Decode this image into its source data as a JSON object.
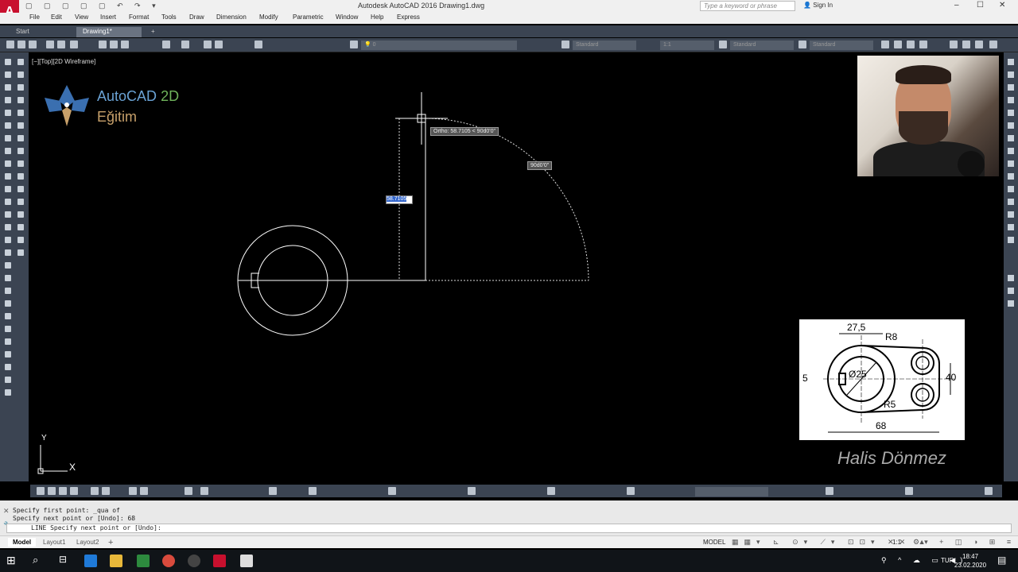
{
  "window": {
    "title": "Autodesk AutoCAD 2016    Drawing1.dwg",
    "app_icon": "A",
    "search_placeholder": "Type a keyword or phrase",
    "signin": "Sign In",
    "minimize": "–",
    "restore": "☐",
    "close": "✕"
  },
  "menu": [
    "File",
    "Edit",
    "View",
    "Insert",
    "Format",
    "Tools",
    "Draw",
    "Dimension",
    "Modify",
    "Parametric",
    "Window",
    "Help",
    "Express"
  ],
  "tabs": [
    {
      "label": "Start",
      "active": false
    },
    {
      "label": "Drawing1*",
      "active": true
    }
  ],
  "tab_add": "+",
  "toolbar": {
    "layer_value": "0",
    "textstyle": "Standard",
    "scale": "1:1",
    "dimstyle": "Standard",
    "tablestyle": "Standard"
  },
  "viewport": {
    "label": "[−][Top][2D Wireframe]"
  },
  "logo": {
    "line1": "AutoCAD",
    "line1b": "2D",
    "line2": "Eğitim"
  },
  "drawing": {
    "ortho_tooltip": "Ortho: 58.7105 < 90d0'0\"",
    "angle_tooltip": "90d0'0\"",
    "dyn_input": "58.7105",
    "ucs_x": "X",
    "ucs_y": "Y"
  },
  "reference": {
    "dim_top": "27,5",
    "dim_r8": "R8",
    "dim_dia": "Ø25",
    "dim_5": "5",
    "dim_40": "40",
    "dim_r5": "R5",
    "dim_68": "68"
  },
  "author": "Halis Dönmez",
  "command": {
    "history": [
      "Specify first point: _qua of",
      "Specify next point or [Undo]: 68"
    ],
    "prompt": "LINE Specify next point or [Undo]:"
  },
  "status_tabs": [
    {
      "label": "Model",
      "active": true
    },
    {
      "label": "Layout1",
      "active": false
    },
    {
      "label": "Layout2",
      "active": false
    }
  ],
  "status": {
    "model": "MODEL",
    "scale": "1:1"
  },
  "taskbar": {
    "lang": "TUR",
    "time": "18:47",
    "date": "23.02.2020"
  }
}
